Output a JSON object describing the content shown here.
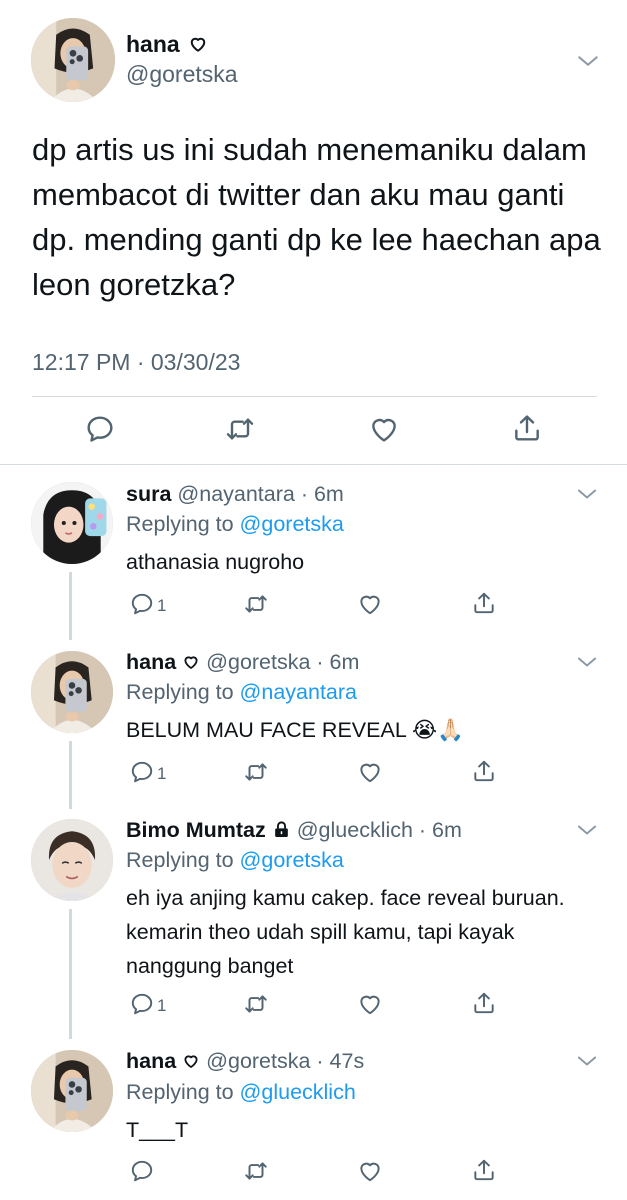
{
  "main_tweet": {
    "name": "hana",
    "handle": "@goretska",
    "text": "dp artis us ini sudah menemaniku dalam membacot di twitter dan aku mau ganti dp. mending ganti dp ke lee haechan apa leon goretzka?",
    "time": "12:17 PM",
    "date": "03/30/23",
    "meta": "12:17 PM · 03/30/23"
  },
  "replies": [
    {
      "name": "sura",
      "handle": "@nayantara",
      "age": "6m",
      "handle_age": "@nayantara · 6m",
      "replying_prefix": "Replying to ",
      "replying_to": "@goretska",
      "text": "athanasia nugroho",
      "reply_count": "1"
    },
    {
      "name": "hana",
      "handle": "@goretska",
      "age": "6m",
      "handle_age": "@goretska · 6m",
      "replying_prefix": "Replying to ",
      "replying_to": "@nayantara",
      "text": "BELUM MAU FACE REVEAL",
      "emoji": "😭🙏🏻",
      "reply_count": "1"
    },
    {
      "name": "Bimo Mumtaz",
      "handle": "@gluecklich",
      "age": "6m",
      "handle_age": "@gluecklich · 6m",
      "replying_prefix": "Replying to ",
      "replying_to": "@goretska",
      "text": "eh iya anjing kamu cakep. face reveal buruan. kemarin theo udah spill kamu, tapi kayak nanggung banget",
      "reply_count": "1"
    },
    {
      "name": "hana",
      "handle": "@goretska",
      "age": "47s",
      "handle_age": "@goretska · 47s",
      "replying_prefix": "Replying to ",
      "replying_to": "@gluecklich",
      "text": "T___T",
      "reply_count": ""
    }
  ],
  "icons": {
    "heart_outline": "heart-outline-icon",
    "lock": "lock-icon",
    "chevron": "chevron-down-icon",
    "reply": "reply-icon",
    "retweet": "retweet-icon",
    "like": "like-icon",
    "share": "share-icon"
  },
  "colors": {
    "text": "#0f1419",
    "secondary": "#536471",
    "link": "#1d9bf0",
    "divider": "#d5dbe0"
  }
}
